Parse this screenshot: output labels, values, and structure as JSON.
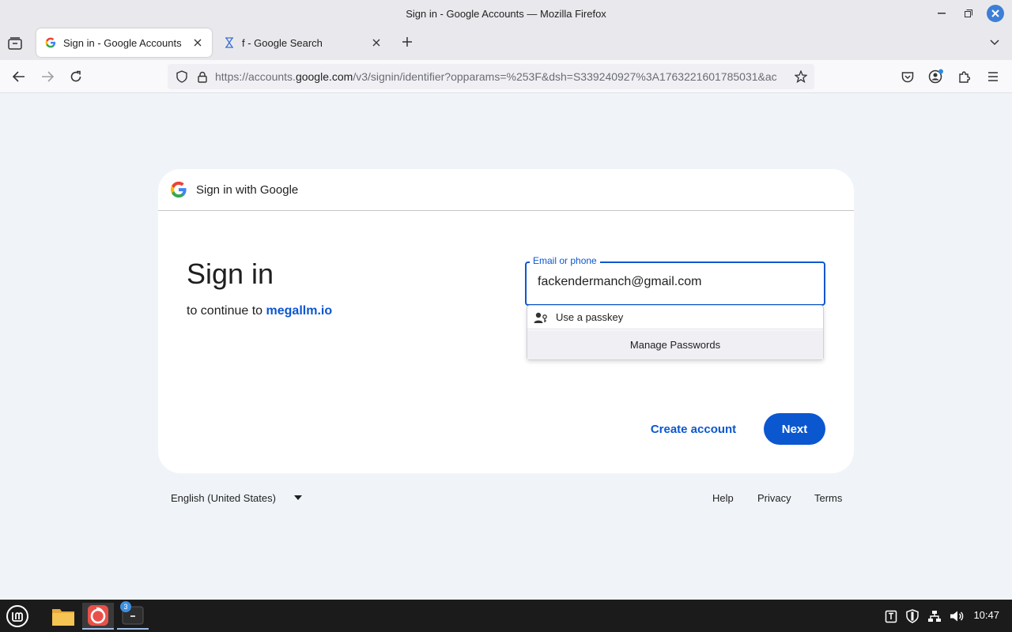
{
  "window": {
    "title": "Sign in - Google Accounts — Mozilla Firefox"
  },
  "tabs": [
    {
      "label": "Sign in - Google Accounts",
      "active": true
    },
    {
      "label": "f - Google Search",
      "active": false
    }
  ],
  "urlbar": {
    "url_prefix": "https://accounts.",
    "url_domain": "google.com",
    "url_rest": "/v3/signin/identifier?opparams=%253F&dsh=S339240927%3A1763221601785031&ac"
  },
  "card": {
    "header_text": "Sign in with Google",
    "title": "Sign in",
    "continue_prefix": "to continue to",
    "continue_link": "megallm.io",
    "email_label": "Email or phone",
    "email_value": "fackendermanch@gmail.com",
    "create_account": "Create account",
    "next": "Next"
  },
  "autocomplete": {
    "passkey": "Use a passkey",
    "manage": "Manage Passwords"
  },
  "footer": {
    "language": "English (United States)",
    "help": "Help",
    "privacy": "Privacy",
    "terms": "Terms"
  },
  "taskbar": {
    "terminal_badge": "3",
    "clock": "10:47"
  },
  "colors": {
    "accent": "#0b57d0",
    "page_bg": "#f0f4f9"
  }
}
